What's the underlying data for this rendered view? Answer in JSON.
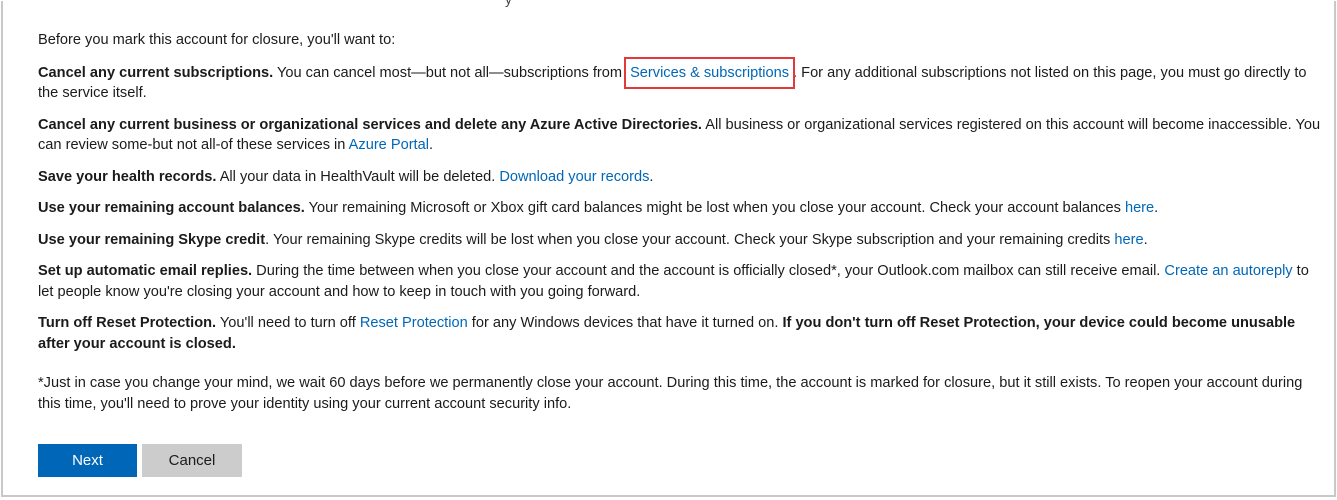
{
  "top_cut_text": "y",
  "intro": "Before you mark this account for closure, you'll want to:",
  "items": [
    {
      "title": "Cancel any current subscriptions.",
      "text_before": " You can cancel most—but not all—subscriptions from ",
      "link": "Services & subscriptions",
      "text_after": ". For any additional subscriptions not listed on this page, you must go directly to the service itself."
    },
    {
      "title": "Cancel any current business or organizational services and delete any Azure Active Directories.",
      "text_before": " All business or organizational services registered on this account will become inaccessible. You can review some-but not all-of these services in ",
      "link": "Azure Portal",
      "text_after": "."
    },
    {
      "title": "Save your health records.",
      "text_before": " All your data in HealthVault will be deleted. ",
      "link": "Download your records",
      "text_after": "."
    },
    {
      "title": "Use your remaining account balances.",
      "text_before": " Your remaining Microsoft or Xbox gift card balances might be lost when you close your account. Check your account balances ",
      "link": "here",
      "text_after": "."
    },
    {
      "title": "Use your remaining Skype credit",
      "text_before": ". Your remaining Skype credits will be lost when you close your account. Check your Skype subscription and your remaining credits ",
      "link": "here",
      "text_after": "."
    },
    {
      "title": "Set up automatic email replies.",
      "text_before": " During the time between when you close your account and the account is officially closed*, your Outlook.com mailbox can still receive email. ",
      "link": "Create an autoreply",
      "text_after": " to let people know you're closing your account and how to keep in touch with you going forward."
    },
    {
      "title": "Turn off Reset Protection.",
      "text_before": " You'll need to turn off ",
      "link": "Reset Protection",
      "text_after": " for any Windows devices that have it turned on. ",
      "bold_tail": "If you don't turn off Reset Protection, your device could become unusable after your account is closed."
    }
  ],
  "footnote": "*Just in case you change your mind, we wait 60 days before we permanently close your account. During this time, the account is marked for closure, but it still exists. To reopen your account during this time, you'll need to prove your identity using your current account security info.",
  "buttons": {
    "next": "Next",
    "cancel": "Cancel"
  },
  "colors": {
    "link": "#0067b8",
    "primary_button": "#0067b8",
    "secondary_button": "#cccccc",
    "highlight_box": "#e03a3a"
  }
}
